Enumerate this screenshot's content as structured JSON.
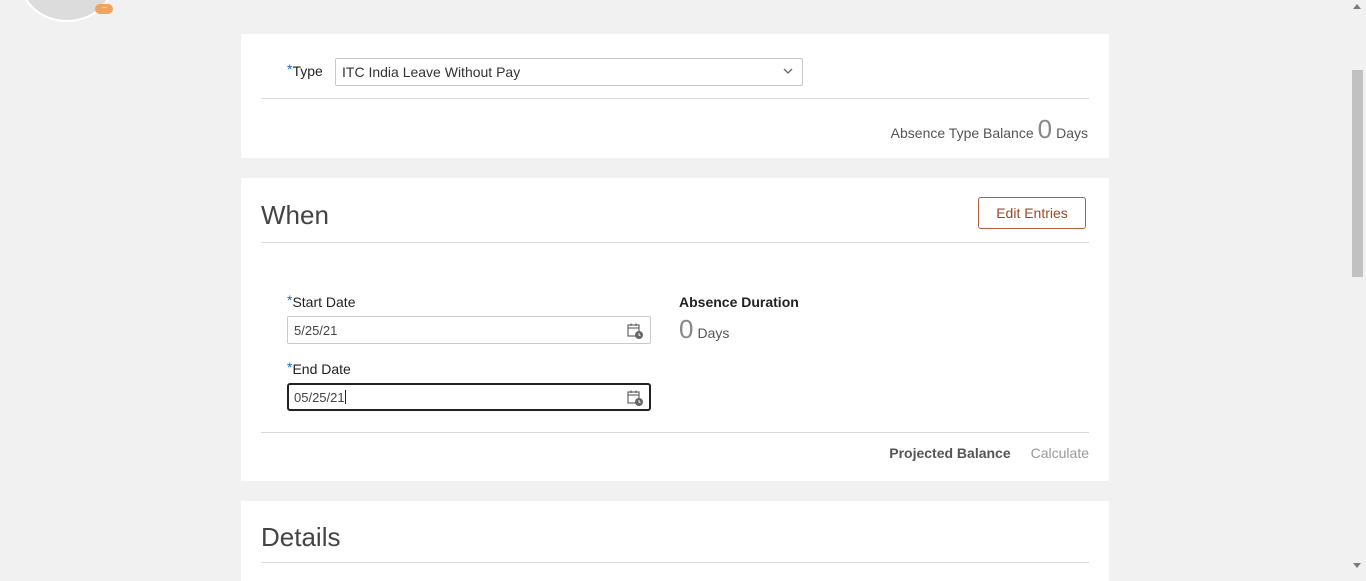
{
  "type_section": {
    "required_mark": "*",
    "type_label": "Type",
    "type_value": "ITC India Leave Without Pay",
    "balance_label": "Absence Type Balance",
    "balance_value": "0",
    "balance_unit": "Days"
  },
  "when_section": {
    "title": "When",
    "edit_entries_label": "Edit Entries",
    "start_date_label": "Start Date",
    "start_date_value": "5/25/21",
    "end_date_label": "End Date",
    "end_date_value": "05/25/21",
    "duration_label": "Absence Duration",
    "duration_value": "0",
    "duration_unit": "Days",
    "projected_balance_label": "Projected Balance",
    "calculate_label": "Calculate"
  },
  "details_section": {
    "title": "Details"
  },
  "avatar": {
    "badge_text": "···"
  },
  "colors": {
    "accent_button": "#9b4a25",
    "required_mark": "#1a6bb8",
    "badge": "#f0a35c"
  },
  "icons": [
    "chevron-down-icon",
    "calendar-icon",
    "calendar-icon"
  ]
}
